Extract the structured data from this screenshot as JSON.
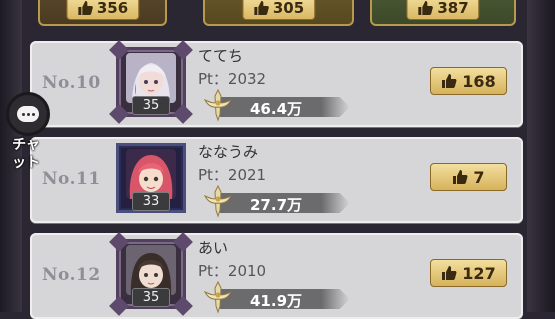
{
  "top_likes": [
    "356",
    "305",
    "387"
  ],
  "rows": [
    {
      "rank": "No.10",
      "name": "ててち",
      "pt": "Pt：2032",
      "level": "35",
      "power": "46.4万",
      "likes": "168",
      "frame": "ornate"
    },
    {
      "rank": "No.11",
      "name": "ななうみ",
      "pt": "Pt：2021",
      "level": "33",
      "power": "27.7万",
      "likes": "7",
      "frame": "plain"
    },
    {
      "rank": "No.12",
      "name": "あい",
      "pt": "Pt：2010",
      "level": "35",
      "power": "41.9万",
      "likes": "127",
      "frame": "ornate"
    }
  ],
  "chat": {
    "label_line1": "チャ",
    "label_line2": "ット"
  },
  "icons": {
    "like": "thumbs-up-icon",
    "chat": "speech-bubble-icon",
    "power": "sword-emblem-icon"
  },
  "colors": {
    "row_bg": "#d6d6d8",
    "gold_button": "#e6c877",
    "rank_text": "#8f8f98"
  }
}
